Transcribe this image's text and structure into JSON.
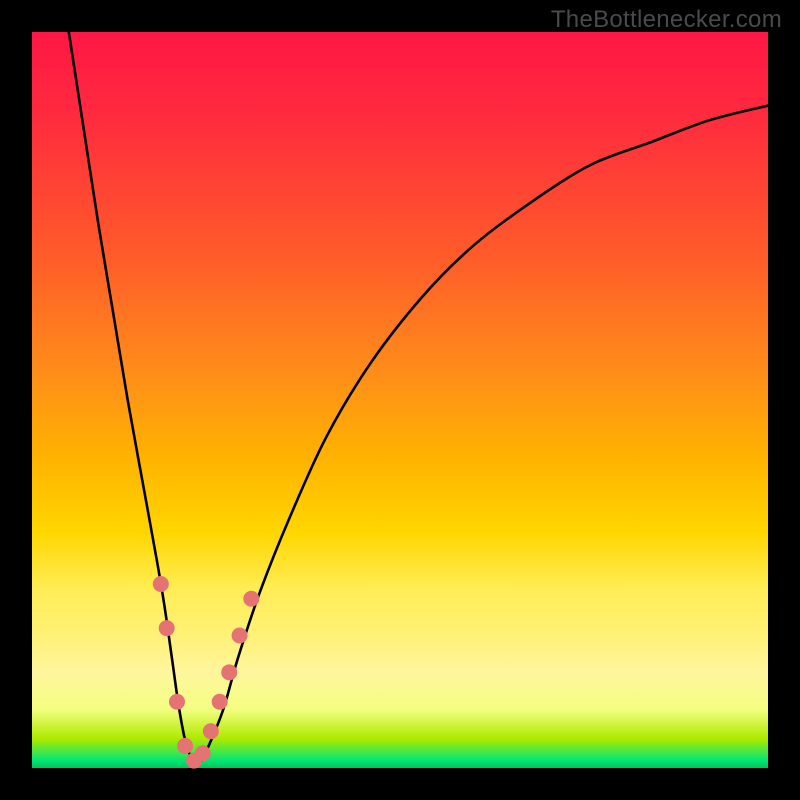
{
  "attribution": "TheBottlenecker.com",
  "chart_data": {
    "type": "line",
    "title": "",
    "xlabel": "",
    "ylabel": "",
    "xlim": [
      0,
      100
    ],
    "ylim": [
      0,
      100
    ],
    "series": [
      {
        "name": "bottleneck-curve",
        "x": [
          5,
          7,
          9,
          11,
          13,
          15,
          17,
          18,
          19,
          20,
          21,
          22,
          23,
          24,
          26,
          28,
          31,
          35,
          40,
          46,
          53,
          60,
          68,
          76,
          84,
          92,
          100
        ],
        "y": [
          100,
          87,
          74,
          62,
          50,
          39,
          28,
          22,
          15,
          8,
          3,
          1,
          1,
          3,
          8,
          15,
          24,
          34,
          45,
          55,
          64,
          71,
          77,
          82,
          85,
          88,
          90
        ]
      }
    ],
    "markers": {
      "name": "highlight-dots",
      "color": "#e57373",
      "radius": 8,
      "points": [
        {
          "x": 17.5,
          "y": 25
        },
        {
          "x": 18.3,
          "y": 19
        },
        {
          "x": 19.7,
          "y": 9
        },
        {
          "x": 20.8,
          "y": 3
        },
        {
          "x": 22.0,
          "y": 1
        },
        {
          "x": 23.2,
          "y": 2
        },
        {
          "x": 24.3,
          "y": 5
        },
        {
          "x": 25.5,
          "y": 9
        },
        {
          "x": 26.8,
          "y": 13
        },
        {
          "x": 28.2,
          "y": 18
        },
        {
          "x": 29.8,
          "y": 23
        }
      ]
    }
  }
}
